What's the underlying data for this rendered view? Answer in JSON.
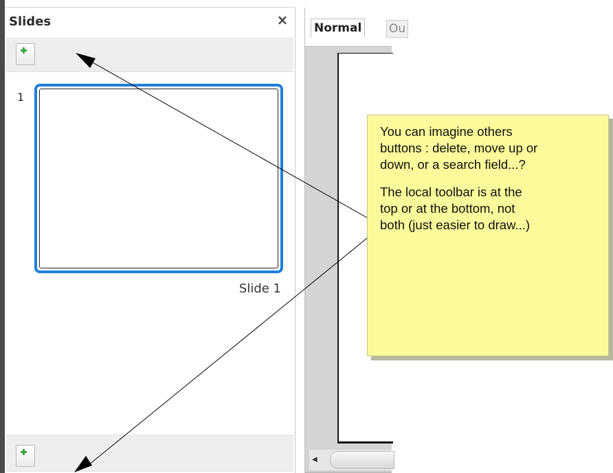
{
  "slides_pane": {
    "title": "Slides",
    "close_glyph": "×",
    "toolbar_icon": "new-slide-icon",
    "slides": [
      {
        "number": "1",
        "name": "Slide 1"
      }
    ]
  },
  "editor": {
    "tabs": {
      "normal": "Normal",
      "outline": "Ou"
    },
    "scroll_left_glyph": "◀"
  },
  "note": {
    "paragraph1": "You can imagine others\nbuttons : delete, move up or\ndown, or a search field...?",
    "paragraph2": "The local toolbar is at the\ntop or at the bottom, not\nboth (just easier to draw...)"
  },
  "colors": {
    "selection_blue": "#1f7fd8",
    "note_fill": "#fbfb9b",
    "icon_green": "#3aa63a"
  }
}
